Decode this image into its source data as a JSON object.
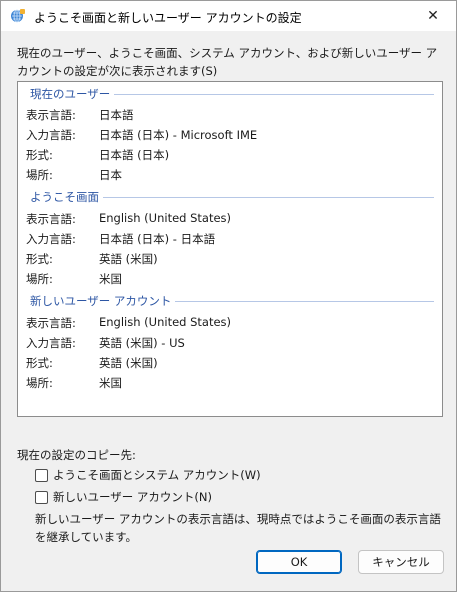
{
  "window": {
    "title": "ようこそ画面と新しいユーザー アカウントの設定",
    "close_glyph": "✕"
  },
  "intro": "現在のユーザー、ようこそ画面、システム アカウント、および新しいユーザー アカウントの設定が次に表示されます(S)",
  "groups": [
    {
      "title": "現在のユーザー",
      "rows": [
        {
          "label": "表示言語:",
          "value": "日本語"
        },
        {
          "label": "入力言語:",
          "value": "日本語 (日本) - Microsoft IME"
        },
        {
          "label": "形式:",
          "value": "日本語 (日本)"
        },
        {
          "label": "場所:",
          "value": "日本"
        }
      ]
    },
    {
      "title": "ようこそ画面",
      "rows": [
        {
          "label": "表示言語:",
          "value": "English (United States)"
        },
        {
          "label": "入力言語:",
          "value": "日本語 (日本) - 日本語"
        },
        {
          "label": "形式:",
          "value": "英語 (米国)"
        },
        {
          "label": "場所:",
          "value": "米国"
        }
      ]
    },
    {
      "title": "新しいユーザー アカウント",
      "rows": [
        {
          "label": "表示言語:",
          "value": "English (United States)"
        },
        {
          "label": "入力言語:",
          "value": "英語 (米国) - US"
        },
        {
          "label": "形式:",
          "value": "英語 (米国)"
        },
        {
          "label": "場所:",
          "value": "米国"
        }
      ]
    }
  ],
  "copy": {
    "label": "現在の設定のコピー先:",
    "options": [
      {
        "label": "ようこそ画面とシステム アカウント(W)",
        "checked": false
      },
      {
        "label": "新しいユーザー アカウント(N)",
        "checked": false
      }
    ]
  },
  "note": "新しいユーザー アカウントの表示言語は、現時点ではようこそ画面の表示言語を継承しています。",
  "buttons": {
    "ok": "OK",
    "cancel": "キャンセル"
  }
}
